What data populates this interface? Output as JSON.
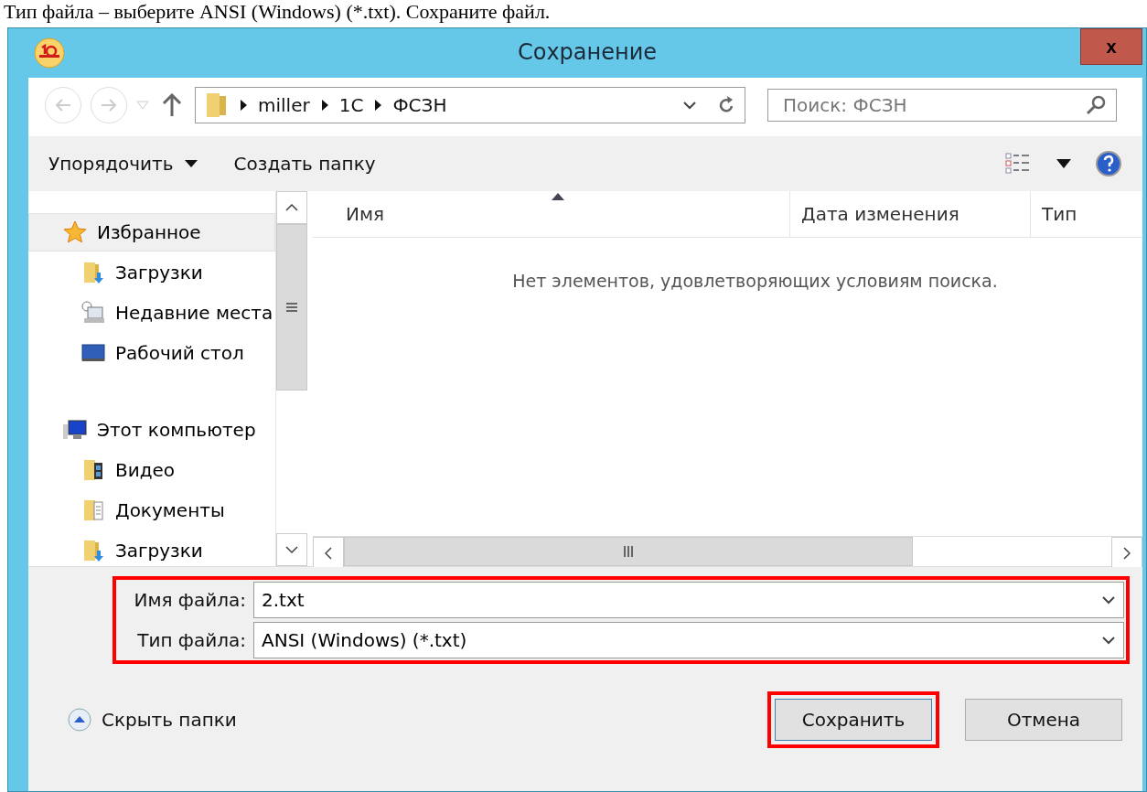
{
  "caption_text": "Тип файла – выберите ANSI (Windows) (*.txt). Сохраните файл.",
  "window": {
    "title": "Сохранение",
    "close": "x"
  },
  "nav": {
    "back_disabled": true,
    "forward_disabled": true,
    "path": [
      "miller",
      "1C",
      "ФСЗН"
    ],
    "search_placeholder": "Поиск: ФСЗН"
  },
  "toolbar": {
    "organize": "Упорядочить",
    "new_folder": "Создать папку"
  },
  "sidebar": {
    "items": [
      {
        "label": "Избранное",
        "kind": "star",
        "selected": true,
        "children": [
          {
            "label": "Загрузки",
            "kind": "download",
            "selected": false
          },
          {
            "label": "Недавние места",
            "kind": "recent",
            "selected": false
          },
          {
            "label": "Рабочий стол",
            "kind": "desktop",
            "selected": false
          }
        ]
      },
      {
        "label": "Этот компьютер",
        "kind": "computer",
        "selected": false,
        "children": [
          {
            "label": "Видео",
            "kind": "video",
            "selected": false
          },
          {
            "label": "Документы",
            "kind": "documents",
            "selected": false
          },
          {
            "label": "Загрузки",
            "kind": "download",
            "selected": false
          }
        ]
      }
    ]
  },
  "table": {
    "columns": [
      {
        "label": "Имя",
        "sorted": true
      },
      {
        "label": "Дата изменения",
        "sorted": false
      },
      {
        "label": "Тип",
        "sorted": false
      }
    ],
    "empty_message": "Нет элементов, удовлетворяющих условиям поиска."
  },
  "file_fields": {
    "highlighted": true,
    "items": [
      {
        "label": "Имя файла:",
        "value": "2.txt"
      },
      {
        "label": "Тип файла:",
        "value": "ANSI (Windows) (*.txt)"
      }
    ]
  },
  "hide_folders": "Скрыть папки",
  "buttons": [
    {
      "label": "Сохранить",
      "highlighted": true
    },
    {
      "label": "Отмена",
      "highlighted": false
    }
  ]
}
